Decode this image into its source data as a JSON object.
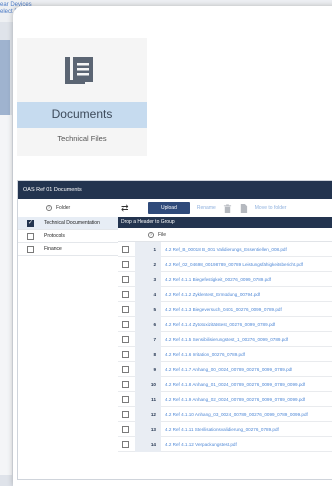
{
  "background": {
    "links": [
      "ear Devices",
      "elect P..."
    ]
  },
  "tile": {
    "title": "Documents",
    "subtitle": "Technical Files",
    "icon": "documents-icon"
  },
  "panel": {
    "title": "OAS Ref 01 Documents",
    "folder_header": "Folder",
    "folders": [
      {
        "label": "Technical Documentation",
        "checked": true
      },
      {
        "label": "Protocols",
        "checked": false
      },
      {
        "label": "Finance",
        "checked": false
      }
    ],
    "toolbar": {
      "upload": "Upload",
      "rename": "Rename",
      "move": "Move to folder"
    },
    "group_bar": "Drop a Header to Group",
    "file_header": "File",
    "files": [
      {
        "num": "1",
        "name": "4.2 Ref_B_00018 B_001 Validierungs_Essentiellen_008.pdf"
      },
      {
        "num": "2",
        "name": "4.2 Ref_02_04698_00198789_00789 Leistungsfähigkeitsbericht.pdf"
      },
      {
        "num": "3",
        "name": "4.2 Ref 4.1.1 Biegefestigkeit_00276_0099_0789.pdf"
      },
      {
        "num": "4",
        "name": "4.2 Ref 4.1.2 Zyklentest_Ermüdung_00794.pdf"
      },
      {
        "num": "5",
        "name": "4.2 Ref 4.1.3 Biegeversuch_0401_00276_0099_0789.pdf"
      },
      {
        "num": "6",
        "name": "4.2 Ref 4.1.4 Zytotoxizitätstest_00276_0099_0789.pdf"
      },
      {
        "num": "7",
        "name": "4.2 Ref 4.1.5 Sensibilisierungstest_1_00276_0099_0789.pdf"
      },
      {
        "num": "8",
        "name": "4.2 Ref 4.1.6 Irritation_00276_0789.pdf"
      },
      {
        "num": "9",
        "name": "4.2 Ref 4.1.7 Anhang_00_0024_00789_00276_0099_0789.pdf"
      },
      {
        "num": "10",
        "name": "4.2 Ref 4.1.8 Anhang_01_0024_00789_00276_0099_0789_0099.pdf"
      },
      {
        "num": "11",
        "name": "4.2 Ref 4.1.9 Anhang_02_0024_00789_00276_0099_0789_0099.pdf"
      },
      {
        "num": "12",
        "name": "4.2 Ref 4.1.10 Anhang_03_0024_00789_00276_0099_0789_0099.pdf"
      },
      {
        "num": "13",
        "name": "4.2 Ref 4.1.11 Sterilisationsvalidierung_00276_0789.pdf"
      },
      {
        "num": "14",
        "name": "4.2 Ref 4.1.12 Verpackungstest.pdf"
      }
    ]
  },
  "colors": {
    "header": "#23344f",
    "accent": "#2f4a7a",
    "link": "#4f88d6",
    "tile_band": "#c6dbef"
  }
}
